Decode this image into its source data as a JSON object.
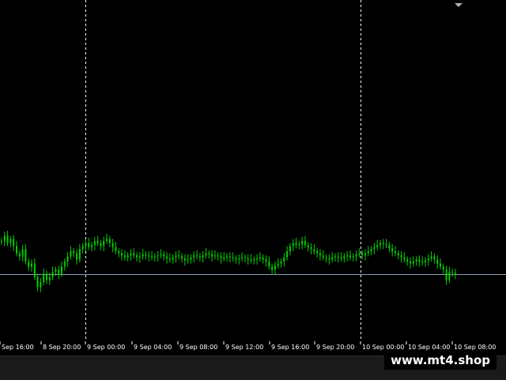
{
  "watermark": "www.mt4.shop",
  "colors": {
    "background": "#000000",
    "candle": "#00d000",
    "grid": "#ffffff",
    "price_line": "#8fa3b8",
    "axis_text": "#ffffff"
  },
  "icons": {
    "shift_marker": "triangle-down-icon"
  },
  "chart_data": {
    "type": "candlestick",
    "title": "",
    "xlabel": "",
    "ylabel": "",
    "x_ticks": [
      "Sep 16:00",
      "8 Sep 20:00",
      "9 Sep 00:00",
      "9 Sep 04:00",
      "9 Sep 08:00",
      "9 Sep 12:00",
      "9 Sep 16:00",
      "9 Sep 20:00",
      "10 Sep 00:00",
      "10 Sep 04:00",
      "10 Sep 08:00"
    ],
    "vertical_separators": [
      "9 Sep 00:00",
      "10 Sep 00:00"
    ],
    "price_line": 0.18,
    "ylim": [
      0,
      1
    ],
    "grid": false,
    "close_series": [
      0.5,
      0.55,
      0.48,
      0.52,
      0.45,
      0.38,
      0.35,
      0.42,
      0.3,
      0.25,
      0.28,
      0.15,
      0.05,
      0.1,
      0.18,
      0.12,
      0.15,
      0.2,
      0.22,
      0.18,
      0.25,
      0.3,
      0.35,
      0.4,
      0.38,
      0.32,
      0.42,
      0.45,
      0.48,
      0.44,
      0.46,
      0.5,
      0.48,
      0.45,
      0.5,
      0.52,
      0.48,
      0.44,
      0.4,
      0.38,
      0.36,
      0.34,
      0.36,
      0.38,
      0.36,
      0.34,
      0.35,
      0.37,
      0.36,
      0.35,
      0.34,
      0.35,
      0.36,
      0.37,
      0.35,
      0.33,
      0.32,
      0.34,
      0.36,
      0.35,
      0.33,
      0.31,
      0.32,
      0.34,
      0.36,
      0.35,
      0.34,
      0.36,
      0.38,
      0.37,
      0.35,
      0.36,
      0.35,
      0.33,
      0.34,
      0.35,
      0.34,
      0.33,
      0.32,
      0.33,
      0.34,
      0.33,
      0.32,
      0.31,
      0.32,
      0.33,
      0.34,
      0.32,
      0.3,
      0.25,
      0.22,
      0.26,
      0.28,
      0.3,
      0.34,
      0.4,
      0.45,
      0.48,
      0.46,
      0.47,
      0.5,
      0.46,
      0.44,
      0.42,
      0.4,
      0.38,
      0.36,
      0.34,
      0.33,
      0.32,
      0.34,
      0.35,
      0.34,
      0.33,
      0.35,
      0.36,
      0.34,
      0.35,
      0.37,
      0.38,
      0.36,
      0.38,
      0.4,
      0.42,
      0.44,
      0.46,
      0.48,
      0.47,
      0.46,
      0.43,
      0.4,
      0.38,
      0.36,
      0.34,
      0.32,
      0.3,
      0.28,
      0.3,
      0.32,
      0.3,
      0.29,
      0.31,
      0.33,
      0.35,
      0.32,
      0.28,
      0.25,
      0.22,
      0.12,
      0.2,
      0.19,
      0.18
    ]
  }
}
